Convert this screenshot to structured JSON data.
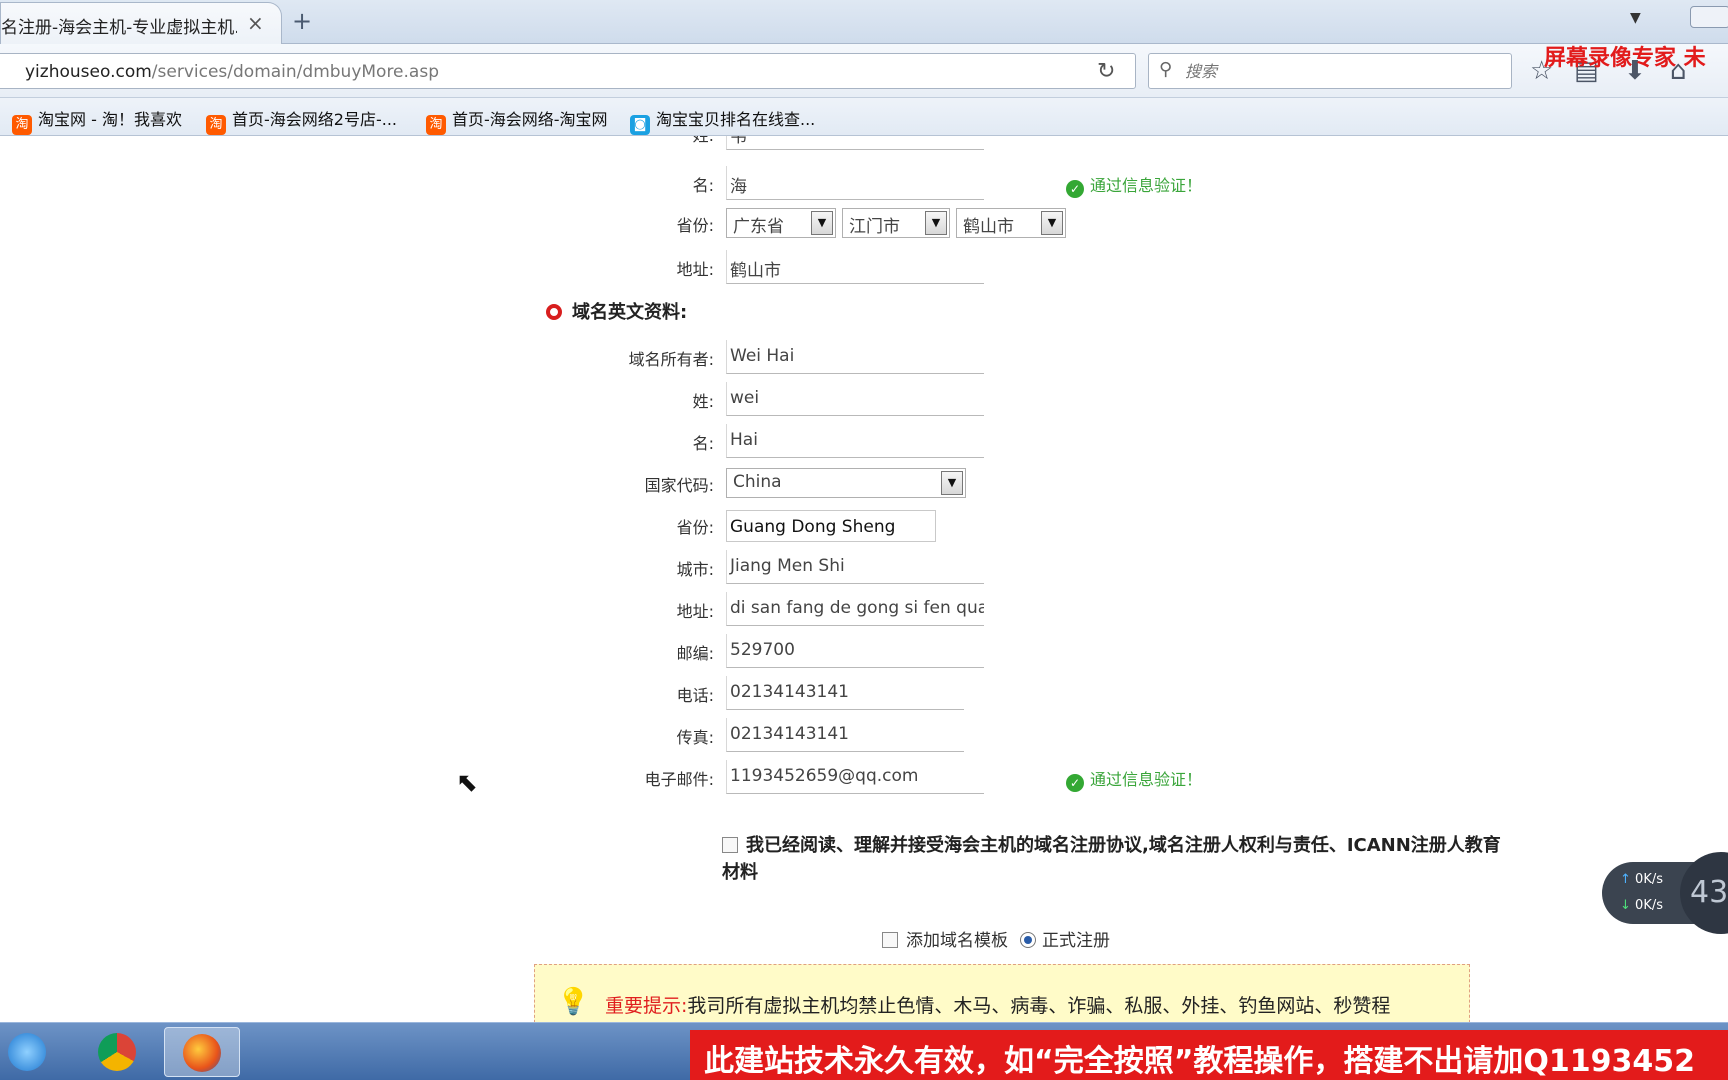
{
  "browser": {
    "tab_title": "名注册-海会主机-专业虚拟主机...",
    "tab_close": "×",
    "new_tab": "+",
    "url_domain": "yizhouseo.com",
    "url_path": "/services/domain/dmbuyMore.asp",
    "search_placeholder": "搜索",
    "icons": [
      "reload-icon",
      "search-icon",
      "star-icon",
      "reading-list-icon",
      "download-icon",
      "home-icon"
    ]
  },
  "watermark_top": "屏幕录像专家 未",
  "bookmarks": [
    {
      "label": "淘宝网 - 淘！我喜欢",
      "icon": "淘"
    },
    {
      "label": "首页-海会网络2号店-...",
      "icon": "淘"
    },
    {
      "label": "首页-海会网络-淘宝网",
      "icon": "淘"
    },
    {
      "label": "淘宝宝贝排名在线查...",
      "icon": "◙"
    }
  ],
  "form_cn": {
    "last_name_label": "姓:",
    "last_name": "韦",
    "first_name_label": "名:",
    "first_name": "海",
    "first_name_status": "通过信息验证！",
    "province_label": "省份:",
    "province": "广东省",
    "city": "江门市",
    "district": "鹤山市",
    "address_label": "地址:",
    "address": "鹤山市"
  },
  "section_en_title": "域名英文资料:",
  "form_en": {
    "owner_label": "域名所有者:",
    "owner": "Wei Hai",
    "last_name_label": "姓:",
    "last_name": "wei",
    "first_name_label": "名:",
    "first_name": "Hai",
    "country_label": "国家代码:",
    "country": "China",
    "province_label": "省份:",
    "province": "Guang Dong Sheng",
    "city_label": "城市:",
    "city": "Jiang Men Shi",
    "address_label": "地址:",
    "address": "di san fang de gong si fen quan",
    "zip_label": "邮编:",
    "zip": "529700",
    "phone_label": "电话:",
    "phone": "02134143141",
    "fax_label": "传真:",
    "fax": "02134143141",
    "email_label": "电子邮件:",
    "email": "1193452659@qq.com",
    "email_status": "通过信息验证！"
  },
  "agreement": {
    "text": "我已经阅读、理解并接受海会主机的域名注册协议,域名注册人权利与责任、ICANN注册人教育材料",
    "checked": false
  },
  "options": {
    "template_label": "添加域名模板",
    "formal_label": "正式注册",
    "selected": "正式注册"
  },
  "notice": {
    "key": "重要提示:",
    "text": "我司所有虚拟主机均禁止色情、木马、病毒、诈骗、私服、外挂、钓鱼网站、秒赞程"
  },
  "speed_widget": {
    "up": "0K/s",
    "down": "0K/s",
    "badge": "43"
  },
  "taskbar": {
    "apps": [
      "ie-icon",
      "chrome-icon",
      "firefox-icon"
    ],
    "active": "firefox-icon"
  },
  "banner_text": "此建站技术永久有效，如“完全按照”教程操作，搭建不出请加Q1193452",
  "colors": {
    "ok_green": "#3aa53a",
    "required_red": "#d81e1e",
    "notice_bg": "#fffbc8",
    "banner_red": "#e31b1b"
  }
}
